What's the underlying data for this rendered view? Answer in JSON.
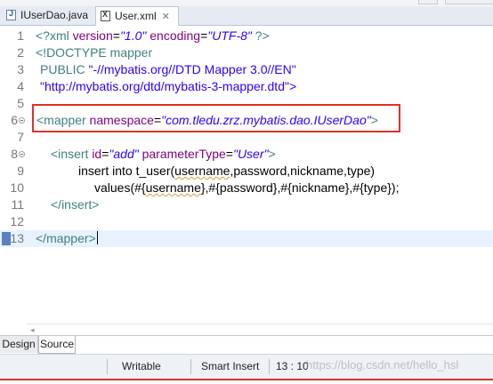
{
  "tabs": [
    {
      "label": "IUserDao.java",
      "icon": "java-file-icon",
      "active": false
    },
    {
      "label": "User.xml",
      "icon": "xml-file-icon",
      "active": true,
      "close": "✕"
    }
  ],
  "editor": {
    "lines": [
      {
        "n": "1"
      },
      {
        "n": "2"
      },
      {
        "n": "3"
      },
      {
        "n": "4"
      },
      {
        "n": "5"
      },
      {
        "n": "6"
      },
      {
        "n": "7"
      },
      {
        "n": "8"
      },
      {
        "n": "9"
      },
      {
        "n": "10"
      },
      {
        "n": "11"
      },
      {
        "n": "12"
      },
      {
        "n": "13"
      }
    ],
    "code": {
      "l1_a": "<?xml ",
      "l1_b": "version",
      "l1_c": "=",
      "l1_d": "\"1.0\"",
      "l1_e": " encoding",
      "l1_f": "=",
      "l1_g": "\"UTF-8\"",
      "l1_h": " ?>",
      "l2": "<!DOCTYPE mapper",
      "l3_a": "PUBLIC ",
      "l3_b": "\"-//mybatis.org//DTD Mapper 3.0//EN\"",
      "l4": "\"http://mybatis.org/dtd/mybatis-3-mapper.dtd\">",
      "l6_a": "<mapper ",
      "l6_b": "namespace",
      "l6_c": "=",
      "l6_d": "\"com.tledu.zrz.mybatis.dao.IUserDao\"",
      "l6_e": ">",
      "l8_a": "<insert ",
      "l8_b": "id",
      "l8_c": "=",
      "l8_d": "\"add\"",
      "l8_e": " parameterType",
      "l8_f": "=",
      "l8_g": "\"User\"",
      "l8_h": ">",
      "l9_a": "insert into t_user(",
      "l9_b": "username",
      "l9_c": ",password,nickname,type)",
      "l10_a": "values(#{",
      "l10_b": "username",
      "l10_c": "},#{password},#{nickname},#{type});",
      "l11": "</insert>",
      "l13": "</mapper>"
    }
  },
  "mode_tabs": {
    "design": "Design",
    "source": "Source"
  },
  "status": {
    "writable": "Writable",
    "insert_mode": "Smart Insert",
    "position": "13 : 10"
  },
  "watermark": "https://blog.csdn.net/hello_hsl",
  "colors": {
    "tag": "#3f7f7f",
    "attr": "#7f007f",
    "value": "#2a00ff",
    "highlight_box": "#e0302a"
  }
}
